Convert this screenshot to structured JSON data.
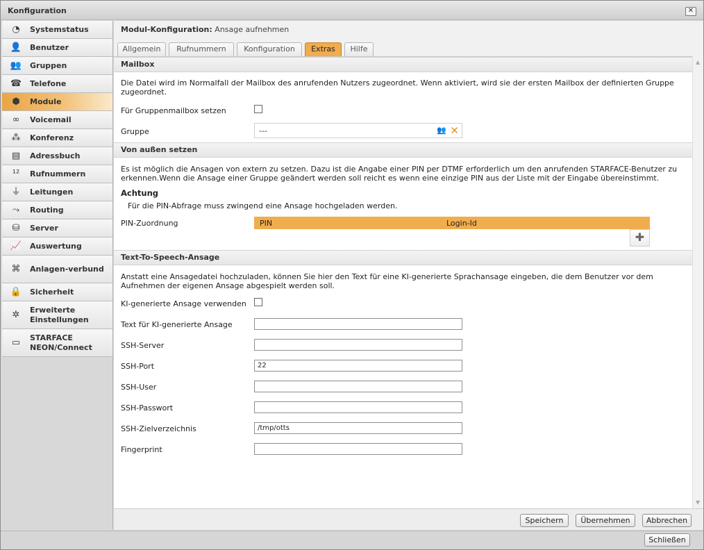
{
  "window": {
    "title": "Konfiguration"
  },
  "sidebar": {
    "items": [
      {
        "label": "Systemstatus",
        "icon": "clock-icon",
        "glyph": "◔"
      },
      {
        "label": "Benutzer",
        "icon": "user-icon",
        "glyph": "👤"
      },
      {
        "label": "Gruppen",
        "icon": "group-icon",
        "glyph": "👥"
      },
      {
        "label": "Telefone",
        "icon": "phone-icon",
        "glyph": "☎"
      },
      {
        "label": "Module",
        "icon": "cube-icon",
        "glyph": "⬢"
      },
      {
        "label": "Voicemail",
        "icon": "voicemail-icon",
        "glyph": "∞"
      },
      {
        "label": "Konferenz",
        "icon": "conference-icon",
        "glyph": "⁂"
      },
      {
        "label": "Adressbuch",
        "icon": "addressbook-icon",
        "glyph": "▤"
      },
      {
        "label": "Rufnummern",
        "icon": "numbers-icon",
        "glyph": "¹²"
      },
      {
        "label": "Leitungen",
        "icon": "plug-icon",
        "glyph": "⏚"
      },
      {
        "label": "Routing",
        "icon": "routing-icon",
        "glyph": "⤳"
      },
      {
        "label": "Server",
        "icon": "server-icon",
        "glyph": "⛁"
      },
      {
        "label": "Auswertung",
        "icon": "chart-icon",
        "glyph": "📈"
      },
      {
        "label": "Anlagen-verbund",
        "icon": "network-icon",
        "glyph": "⌘"
      },
      {
        "label": "Sicherheit",
        "icon": "lock-icon",
        "glyph": "🔒"
      },
      {
        "label": "Erweiterte Einstellungen",
        "icon": "advanced-settings-icon",
        "glyph": "✲"
      },
      {
        "label": "STARFACE NEON/Connect",
        "icon": "camera-icon",
        "glyph": "▭"
      }
    ],
    "active_index": 4
  },
  "main": {
    "header_bold": "Modul-Konfiguration:",
    "header_sub": "Ansage aufnehmen",
    "tabs": [
      {
        "label": "Allgemein"
      },
      {
        "label": "Rufnummern"
      },
      {
        "label": "Konfiguration"
      },
      {
        "label": "Extras"
      },
      {
        "label": "Hilfe"
      }
    ],
    "active_tab": "Extras"
  },
  "mailbox": {
    "title": "Mailbox",
    "description": "Die Datei wird im Normalfall der Mailbox des anrufenden Nutzers zugeordnet. Wenn aktiviert, wird sie der ersten Mailbox der definierten Gruppe zugeordnet.",
    "group_mailbox_label": "Für Gruppenmailbox setzen",
    "group_mailbox_checked": false,
    "group_label": "Gruppe",
    "group_value": "---"
  },
  "extern": {
    "title": "Von außen setzen",
    "description": "Es ist möglich die Ansagen von extern zu setzen. Dazu ist die Angabe einer PIN per DTMF erforderlich um den anrufenden STARFACE-Benutzer zu erkennen.Wenn die Ansage einer Gruppe geändert werden soll reicht es wenn eine einzige PIN aus der Liste mit der Eingabe übereinstimmt.",
    "warning_title": "Achtung",
    "warning_text": "Für die PIN-Abfrage muss zwingend eine Ansage hochgeladen werden.",
    "pin_label": "PIN-Zuordnung",
    "columns": [
      "PIN",
      "Login-Id"
    ],
    "rows": []
  },
  "tts": {
    "title": "Text-To-Speech-Ansage",
    "description": "Anstatt eine Ansagedatei hochzuladen, können Sie hier den Text für eine KI-generierte Sprachansage eingeben, die dem Benutzer vor dem Aufnehmen der eigenen Ansage abgespielt werden soll.",
    "use_ai_label": "KI-generierte Ansage verwenden",
    "use_ai_checked": false,
    "fields": {
      "text": {
        "label": "Text für KI-generierte Ansage",
        "value": ""
      },
      "server": {
        "label": "SSH-Server",
        "value": ""
      },
      "port": {
        "label": "SSH-Port",
        "value": "22"
      },
      "user": {
        "label": "SSH-User",
        "value": ""
      },
      "password": {
        "label": "SSH-Passwort",
        "value": ""
      },
      "dir": {
        "label": "SSH-Zielverzeichnis",
        "value": "/tmp/otts"
      },
      "fingerprint": {
        "label": "Fingerprint",
        "value": ""
      }
    }
  },
  "buttons": {
    "save": "Speichern",
    "apply": "Übernehmen",
    "cancel": "Abbrechen",
    "close": "Schließen"
  }
}
